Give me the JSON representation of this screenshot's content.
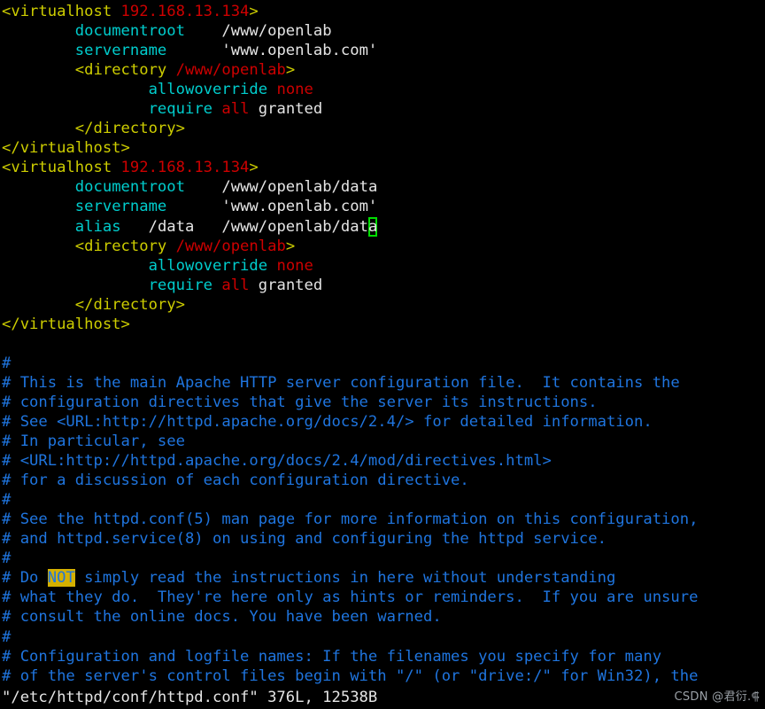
{
  "app": {
    "name": "vim",
    "terminal_background": "#000000",
    "cursor_color": "#00dd00"
  },
  "colors": {
    "tag": "#cdcd00",
    "tag_value": "#cd0000",
    "directive": "#00cdcd",
    "plain": "#e5e5e5",
    "comment": "#1f75df",
    "search_highlight_bg": "#d4b000",
    "cursor_outline": "#00dd00",
    "watermark": "#9aa0a6"
  },
  "buffer": {
    "lines": [
      {
        "id": "l01",
        "segments": [
          {
            "text": "<virtualhost ",
            "style": "tag"
          },
          {
            "text": "192.168.13.134",
            "style": "val"
          },
          {
            "text": ">",
            "style": "tag"
          }
        ]
      },
      {
        "id": "l02",
        "segments": [
          {
            "text": "        ",
            "style": "plain"
          },
          {
            "text": "documentroot",
            "style": "key"
          },
          {
            "text": "    /www/openlab",
            "style": "plain"
          }
        ]
      },
      {
        "id": "l03",
        "segments": [
          {
            "text": "        ",
            "style": "plain"
          },
          {
            "text": "servername",
            "style": "key"
          },
          {
            "text": "      'www.openlab.com'",
            "style": "plain"
          }
        ]
      },
      {
        "id": "l04",
        "segments": [
          {
            "text": "        ",
            "style": "plain"
          },
          {
            "text": "<directory ",
            "style": "tag"
          },
          {
            "text": "/www/openlab",
            "style": "val"
          },
          {
            "text": ">",
            "style": "tag"
          }
        ]
      },
      {
        "id": "l05",
        "segments": [
          {
            "text": "                ",
            "style": "plain"
          },
          {
            "text": "allowoverride",
            "style": "key"
          },
          {
            "text": " ",
            "style": "plain"
          },
          {
            "text": "none",
            "style": "kwred"
          }
        ]
      },
      {
        "id": "l06",
        "segments": [
          {
            "text": "                ",
            "style": "plain"
          },
          {
            "text": "require",
            "style": "key"
          },
          {
            "text": " ",
            "style": "plain"
          },
          {
            "text": "all",
            "style": "kwred"
          },
          {
            "text": " granted",
            "style": "plain"
          }
        ]
      },
      {
        "id": "l07",
        "segments": [
          {
            "text": "        ",
            "style": "plain"
          },
          {
            "text": "</directory>",
            "style": "tag"
          }
        ]
      },
      {
        "id": "l08",
        "segments": [
          {
            "text": "</virtualhost>",
            "style": "tag"
          }
        ]
      },
      {
        "id": "l09",
        "segments": [
          {
            "text": "<virtualhost ",
            "style": "tag"
          },
          {
            "text": "192.168.13.134",
            "style": "val"
          },
          {
            "text": ">",
            "style": "tag"
          }
        ]
      },
      {
        "id": "l10",
        "segments": [
          {
            "text": "        ",
            "style": "plain"
          },
          {
            "text": "documentroot",
            "style": "key"
          },
          {
            "text": "    /www/openlab/data",
            "style": "plain"
          }
        ]
      },
      {
        "id": "l11",
        "segments": [
          {
            "text": "        ",
            "style": "plain"
          },
          {
            "text": "servername",
            "style": "key"
          },
          {
            "text": "      'www.openlab.com'",
            "style": "plain"
          }
        ]
      },
      {
        "id": "l12",
        "segments": [
          {
            "text": "        ",
            "style": "plain"
          },
          {
            "text": "alias",
            "style": "key"
          },
          {
            "text": "   /data   /www/openlab/dat",
            "style": "plain"
          },
          {
            "text": "a",
            "style": "cursor"
          }
        ]
      },
      {
        "id": "l13",
        "segments": [
          {
            "text": "        ",
            "style": "plain"
          },
          {
            "text": "<directory ",
            "style": "tag"
          },
          {
            "text": "/www/openlab",
            "style": "val"
          },
          {
            "text": ">",
            "style": "tag"
          }
        ]
      },
      {
        "id": "l14",
        "segments": [
          {
            "text": "                ",
            "style": "plain"
          },
          {
            "text": "allowoverride",
            "style": "key"
          },
          {
            "text": " ",
            "style": "plain"
          },
          {
            "text": "none",
            "style": "kwred"
          }
        ]
      },
      {
        "id": "l15",
        "segments": [
          {
            "text": "                ",
            "style": "plain"
          },
          {
            "text": "require",
            "style": "key"
          },
          {
            "text": " ",
            "style": "plain"
          },
          {
            "text": "all",
            "style": "kwred"
          },
          {
            "text": " granted",
            "style": "plain"
          }
        ]
      },
      {
        "id": "l16",
        "segments": [
          {
            "text": "        ",
            "style": "plain"
          },
          {
            "text": "</directory>",
            "style": "tag"
          }
        ]
      },
      {
        "id": "l17",
        "segments": [
          {
            "text": "</virtualhost>",
            "style": "tag"
          }
        ]
      },
      {
        "id": "l18",
        "segments": []
      },
      {
        "id": "l19",
        "segments": [
          {
            "text": "#",
            "style": "comment"
          }
        ]
      },
      {
        "id": "l20",
        "segments": [
          {
            "text": "# This is the main Apache HTTP server configuration file.  It contains the",
            "style": "comment"
          }
        ]
      },
      {
        "id": "l21",
        "segments": [
          {
            "text": "# configuration directives that give the server its instructions.",
            "style": "comment"
          }
        ]
      },
      {
        "id": "l22",
        "segments": [
          {
            "text": "# See <URL:http://httpd.apache.org/docs/2.4/> for detailed information.",
            "style": "comment"
          }
        ]
      },
      {
        "id": "l23",
        "segments": [
          {
            "text": "# In particular, see",
            "style": "comment"
          }
        ]
      },
      {
        "id": "l24",
        "segments": [
          {
            "text": "# <URL:http://httpd.apache.org/docs/2.4/mod/directives.html>",
            "style": "comment"
          }
        ]
      },
      {
        "id": "l25",
        "segments": [
          {
            "text": "# for a discussion of each configuration directive.",
            "style": "comment"
          }
        ]
      },
      {
        "id": "l26",
        "segments": [
          {
            "text": "#",
            "style": "comment"
          }
        ]
      },
      {
        "id": "l27",
        "segments": [
          {
            "text": "# See the httpd.conf(5) man page for more information on this configuration,",
            "style": "comment"
          }
        ]
      },
      {
        "id": "l28",
        "segments": [
          {
            "text": "# and httpd.service(8) on using and configuring the httpd service.",
            "style": "comment"
          }
        ]
      },
      {
        "id": "l29",
        "segments": [
          {
            "text": "#",
            "style": "comment"
          }
        ]
      },
      {
        "id": "l30",
        "segments": [
          {
            "text": "# Do ",
            "style": "comment"
          },
          {
            "text": "NOT",
            "style": "search"
          },
          {
            "text": " simply read the instructions in here without understanding",
            "style": "comment"
          }
        ]
      },
      {
        "id": "l31",
        "segments": [
          {
            "text": "# what they do.  They're here only as hints or reminders.  If you are unsure",
            "style": "comment"
          }
        ]
      },
      {
        "id": "l32",
        "segments": [
          {
            "text": "# consult the online docs. You have been warned.",
            "style": "comment"
          }
        ]
      },
      {
        "id": "l33",
        "segments": [
          {
            "text": "#",
            "style": "comment"
          }
        ]
      },
      {
        "id": "l34",
        "segments": [
          {
            "text": "# Configuration and logfile names: If the filenames you specify for many",
            "style": "comment"
          }
        ]
      },
      {
        "id": "l35",
        "segments": [
          {
            "text": "# of the server's control files begin with \"/\" (or \"drive:/\" for Win32), the",
            "style": "comment"
          }
        ]
      }
    ]
  },
  "statusline": {
    "filename": "\"/etc/httpd/conf/httpd.conf\"",
    "line_count": "376L",
    "byte_count": "12538B",
    "text": "\"/etc/httpd/conf/httpd.conf\" 376L, 12538B"
  },
  "watermark": {
    "text": "CSDN @君衍.⸿"
  }
}
